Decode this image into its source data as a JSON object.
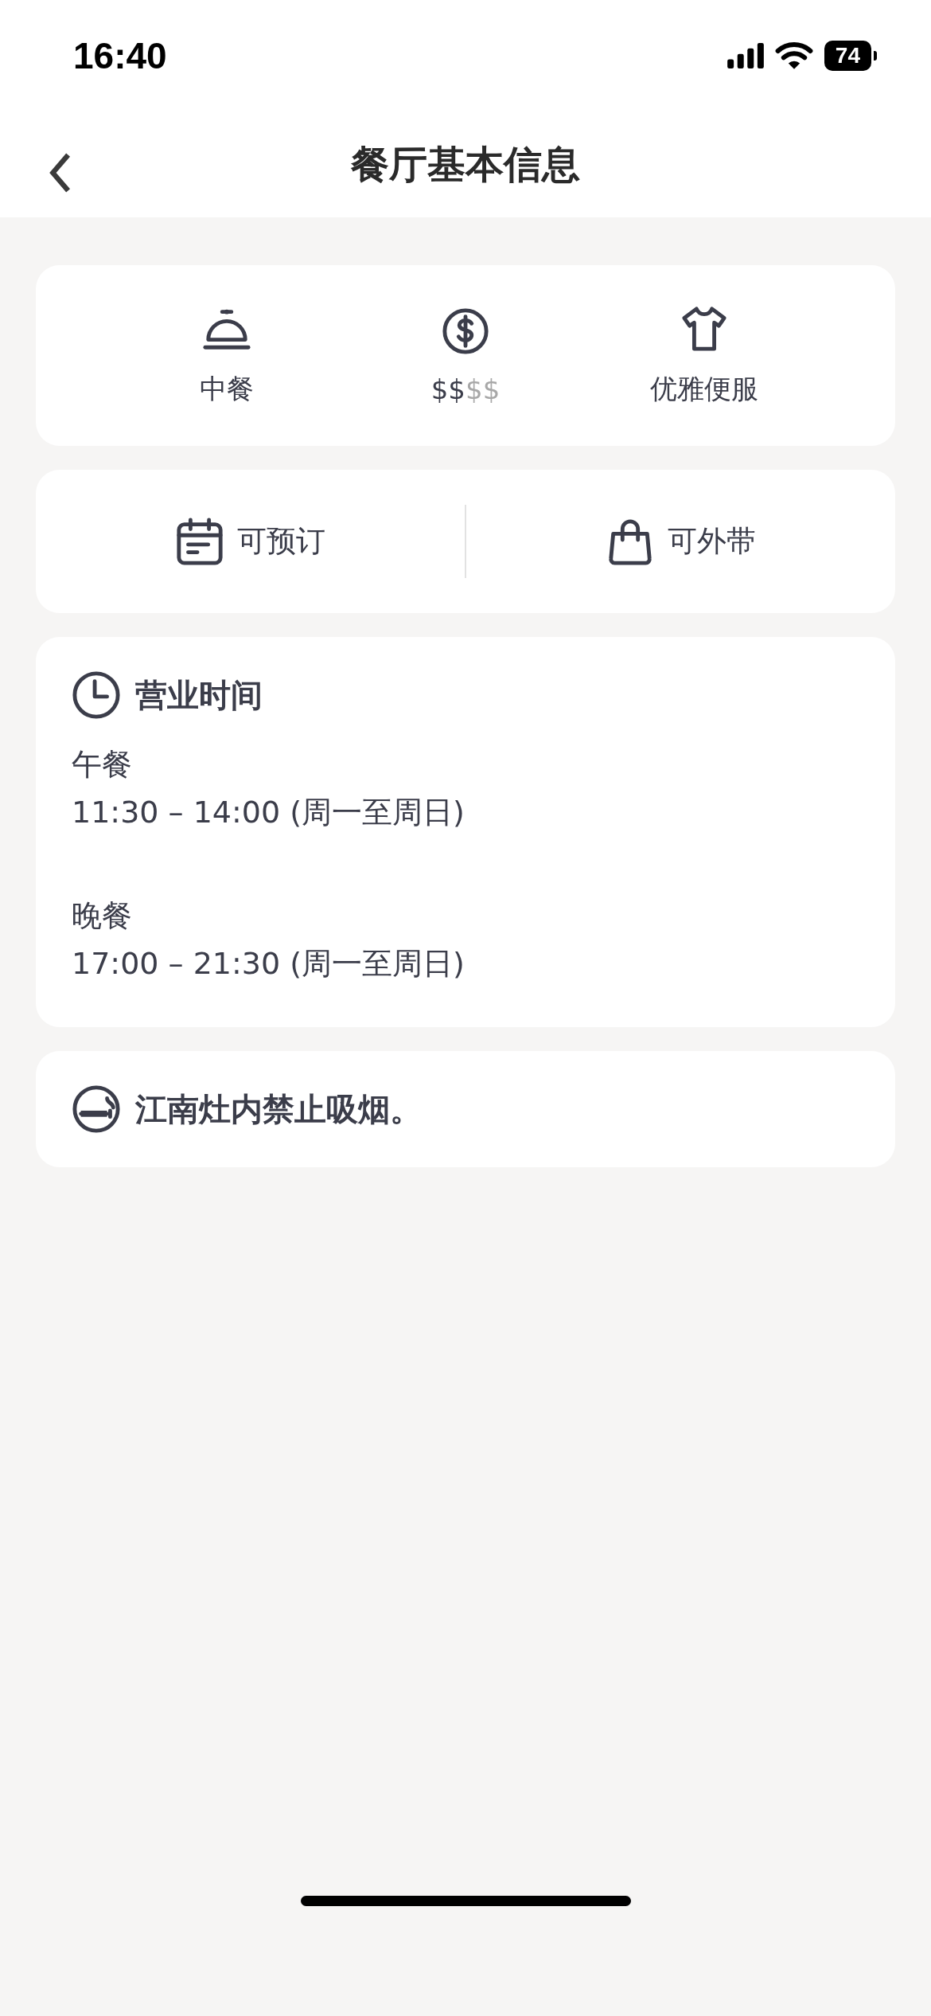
{
  "status_bar": {
    "time": "16:40",
    "battery": "74"
  },
  "nav": {
    "title": "餐厅基本信息"
  },
  "summary": [
    {
      "kind": "cuisine",
      "label": "中餐"
    },
    {
      "kind": "price",
      "price": [
        {
          "symbol": "$",
          "active": true
        },
        {
          "symbol": "$",
          "active": true
        },
        {
          "symbol": "$",
          "active": false
        },
        {
          "symbol": "$",
          "active": false
        }
      ]
    },
    {
      "kind": "dress",
      "label": "优雅便服"
    }
  ],
  "features": [
    {
      "kind": "reservation",
      "label": "可预订"
    },
    {
      "kind": "takeaway",
      "label": "可外带"
    }
  ],
  "hours": {
    "title": "营业时间",
    "meals": [
      {
        "name": "午餐",
        "time": "11:30 – 14:00 (周一至周日)"
      },
      {
        "name": "晚餐",
        "time": "17:00 – 21:30 (周一至周日)"
      }
    ]
  },
  "notice": {
    "text": "江南灶内禁止吸烟。"
  }
}
